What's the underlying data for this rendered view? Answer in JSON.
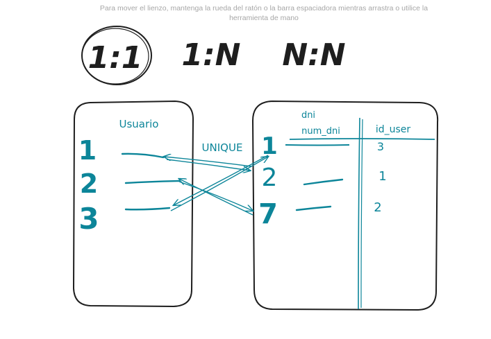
{
  "hint": {
    "line1": "Para mover el lienzo, mantenga la rueda del ratón o la barra espaciadora mientras arrastra o utilice la",
    "line2": "herramienta de mano"
  },
  "cardinalities": {
    "one_to_one": "1:1",
    "one_to_many": "1:N",
    "many_to_many": "N:N"
  },
  "left_table": {
    "title": "Usuario",
    "ids": [
      "1",
      "2",
      "3"
    ]
  },
  "unique_label": "UNIQUE",
  "right_table": {
    "col1_header_top": "dni",
    "col1_header": "num_dni",
    "col2_header": "id_user",
    "ids": [
      "1",
      "2",
      "7"
    ],
    "id_user_values": [
      "3",
      "1",
      "2"
    ]
  },
  "colors": {
    "ink": "#1e1e1e",
    "teal": "#0c8599"
  }
}
